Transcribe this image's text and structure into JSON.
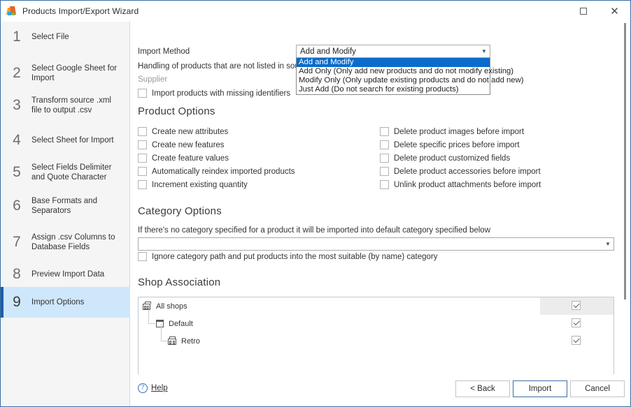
{
  "window": {
    "title": "Products Import/Export Wizard",
    "maximize_label": "maximize",
    "close_label": "close"
  },
  "sidebar": {
    "steps": [
      {
        "num": "1",
        "label": "Select File"
      },
      {
        "num": "2",
        "label": "Select Google Sheet for Import"
      },
      {
        "num": "3",
        "label": "Transform source .xml file to output .csv"
      },
      {
        "num": "4",
        "label": "Select Sheet for Import"
      },
      {
        "num": "5",
        "label": "Select Fields Delimiter and Quote Character"
      },
      {
        "num": "6",
        "label": "Base Formats and Separators"
      },
      {
        "num": "7",
        "label": "Assign .csv Columns to Database Fields"
      },
      {
        "num": "8",
        "label": "Preview Import Data"
      },
      {
        "num": "9",
        "label": "Import Options"
      }
    ],
    "active_index": 8
  },
  "import_method": {
    "label": "Import Method",
    "description": "Handling of products that are not listed in source file",
    "selected": "Add and Modify",
    "options": [
      "Add and Modify",
      "Add Only (Only add new products and do not modify existing)",
      "Modify Only (Only update existing products and do not add new)",
      "Just Add (Do not search for existing products)"
    ],
    "selected_index": 0
  },
  "supplier": {
    "label": "Supplier",
    "missing_identifiers_label": "Import products with missing identifiers",
    "missing_identifiers_checked": false
  },
  "product_options": {
    "heading": "Product Options",
    "left": [
      {
        "label": "Create new attributes",
        "checked": false
      },
      {
        "label": "Create new features",
        "checked": false
      },
      {
        "label": "Create feature values",
        "checked": false
      },
      {
        "label": "Automatically reindex imported products",
        "checked": false
      },
      {
        "label": "Increment existing quantity",
        "checked": false
      }
    ],
    "right": [
      {
        "label": "Delete product images before import",
        "checked": false
      },
      {
        "label": "Delete specific prices before import",
        "checked": false
      },
      {
        "label": "Delete product customized fields",
        "checked": false
      },
      {
        "label": "Delete product accessories before import",
        "checked": false
      },
      {
        "label": "Unlink product attachments before import",
        "checked": false
      }
    ]
  },
  "category_options": {
    "heading": "Category Options",
    "description": "If there's no category specified for a product it will be imported into default category specified below",
    "default_category": "",
    "ignore_path_label": "Ignore category path and put products into the most suitable (by name) category",
    "ignore_path_checked": false
  },
  "shop_association": {
    "heading": "Shop Association",
    "rows": [
      {
        "label": "All shops",
        "icon": "all-shops-icon",
        "depth": 0,
        "checked": true,
        "highlighted": true
      },
      {
        "label": "Default",
        "icon": "shop-group-icon",
        "depth": 1,
        "checked": true,
        "highlighted": false
      },
      {
        "label": "Retro",
        "icon": "shop-icon",
        "depth": 2,
        "checked": true,
        "highlighted": false
      }
    ]
  },
  "footer": {
    "help_label": "Help",
    "back_label": "< Back",
    "import_label": "Import",
    "cancel_label": "Cancel"
  },
  "colors": {
    "accent": "#1c5ea8",
    "active_step_bg": "#cfe7fb",
    "selection_blue": "#0a6ccc",
    "window_border": "#3a6ea5"
  }
}
